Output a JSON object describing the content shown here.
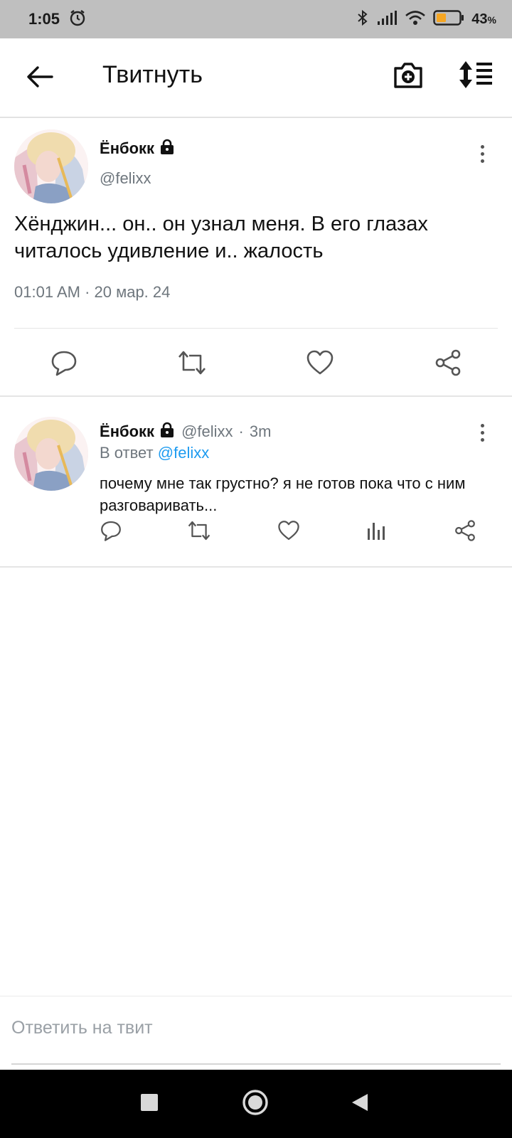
{
  "status_bar": {
    "time": "1:05",
    "battery": "43",
    "battery_unit": "%",
    "icons": [
      "alarm-icon",
      "bluetooth-icon",
      "signal-icon",
      "wifi-icon",
      "battery-icon"
    ]
  },
  "header": {
    "title": "Твитнуть",
    "icons": [
      "back-arrow-icon",
      "camera-plus-icon",
      "sort-list-icon"
    ]
  },
  "main_tweet": {
    "author": "Ёнбокк",
    "handle": "@felixx",
    "text": "Хёнджин... он.. он узнал меня. В его глазах читалось удивление и.. жалость",
    "timestamp": "01:01 AM · 20 мар. 24",
    "actions": [
      "reply-icon",
      "retweet-icon",
      "like-icon",
      "share-icon"
    ]
  },
  "reply_tweet": {
    "author": "Ёнбокк",
    "handle": "@felixx",
    "separator": "·",
    "time_ago": "3m",
    "reply_prefix": "В ответ",
    "reply_mention": "@felixx",
    "text": "почему мне так грустно? я не готов пока что с ним разговаривать...",
    "actions": [
      "reply-icon",
      "retweet-icon",
      "like-icon",
      "analytics-icon",
      "share-icon"
    ]
  },
  "compose": {
    "placeholder": "Ответить на твит"
  },
  "colors": {
    "accent": "#1d9bf0",
    "muted_text": "#6e767d",
    "battery_fill": "#f5a623",
    "status_bar_bg": "#bfbfbf"
  }
}
